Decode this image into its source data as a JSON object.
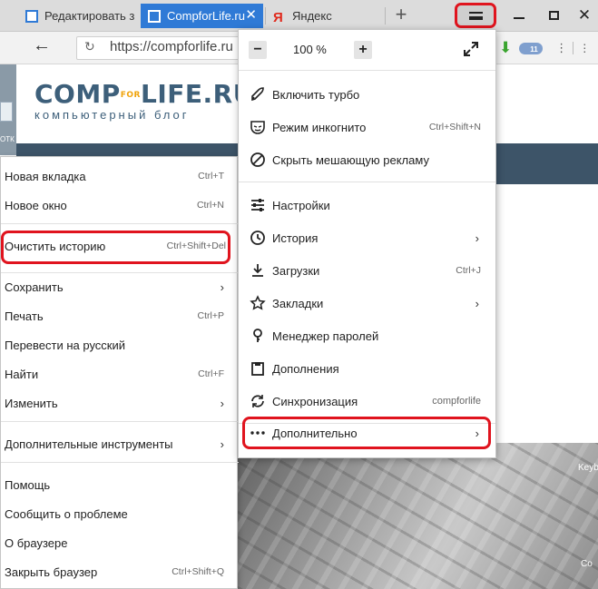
{
  "tabs": [
    {
      "label": "Редактировать з",
      "active": false
    },
    {
      "label": "CompforLife.ru",
      "active": true
    },
    {
      "label": "Яндекс",
      "icon_text": "Я",
      "active": false
    }
  ],
  "toolbar": {
    "url": "https://compforlife.ru",
    "new_tab": "+",
    "badge_count": "11"
  },
  "site": {
    "logo_main_left": "COMP",
    "logo_main_for": "FOR",
    "logo_main_right": "LIFE.RU",
    "logo_sub": "компьютерный блог",
    "left_file_label": "ОТК",
    "keyb_label": "Keyb",
    "co_label": "Co"
  },
  "main_menu": {
    "zoom": {
      "minus": "−",
      "value": "100 %",
      "plus": "+"
    },
    "items": [
      {
        "id": "turbo",
        "label": "Включить турбо"
      },
      {
        "id": "incognito",
        "label": "Режим инкогнито",
        "shortcut": "Ctrl+Shift+N"
      },
      {
        "id": "adblock",
        "label": "Скрыть мешающую рекламу"
      },
      {
        "id": "settings",
        "label": "Настройки"
      },
      {
        "id": "history",
        "label": "История",
        "arrow": "›"
      },
      {
        "id": "downloads",
        "label": "Загрузки",
        "shortcut": "Ctrl+J"
      },
      {
        "id": "bookmarks",
        "label": "Закладки",
        "arrow": "›"
      },
      {
        "id": "passwords",
        "label": "Менеджер паролей"
      },
      {
        "id": "addons",
        "label": "Дополнения"
      },
      {
        "id": "sync",
        "label": "Синхронизация",
        "sub": "compforlife"
      },
      {
        "id": "more",
        "label": "Дополнительно",
        "arrow": "›"
      }
    ]
  },
  "sub_menu": {
    "items": [
      {
        "id": "new-tab",
        "label": "Новая вкладка",
        "shortcut": "Ctrl+T"
      },
      {
        "id": "new-window",
        "label": "Новое окно",
        "shortcut": "Ctrl+N"
      },
      {
        "id": "clear-history",
        "label": "Очистить историю",
        "shortcut": "Ctrl+Shift+Del"
      },
      {
        "id": "save",
        "label": "Сохранить",
        "arrow": "›"
      },
      {
        "id": "print",
        "label": "Печать",
        "shortcut": "Ctrl+P"
      },
      {
        "id": "translate",
        "label": "Перевести на русский"
      },
      {
        "id": "find",
        "label": "Найти",
        "shortcut": "Ctrl+F"
      },
      {
        "id": "edit",
        "label": "Изменить",
        "arrow": "›"
      },
      {
        "id": "dev-tools",
        "label": "Дополнительные инструменты",
        "arrow": "›"
      },
      {
        "id": "help",
        "label": "Помощь"
      },
      {
        "id": "report",
        "label": "Сообщить о проблеме"
      },
      {
        "id": "about",
        "label": "О браузере"
      },
      {
        "id": "quit",
        "label": "Закрыть браузер",
        "shortcut": "Ctrl+Shift+Q"
      }
    ]
  },
  "colors": {
    "highlight": "#e0141e",
    "active_tab": "#2f7ad6",
    "nav_bar": "#3d5468",
    "logo_blue": "#3d5f7a",
    "logo_orange": "#f0a30a"
  }
}
